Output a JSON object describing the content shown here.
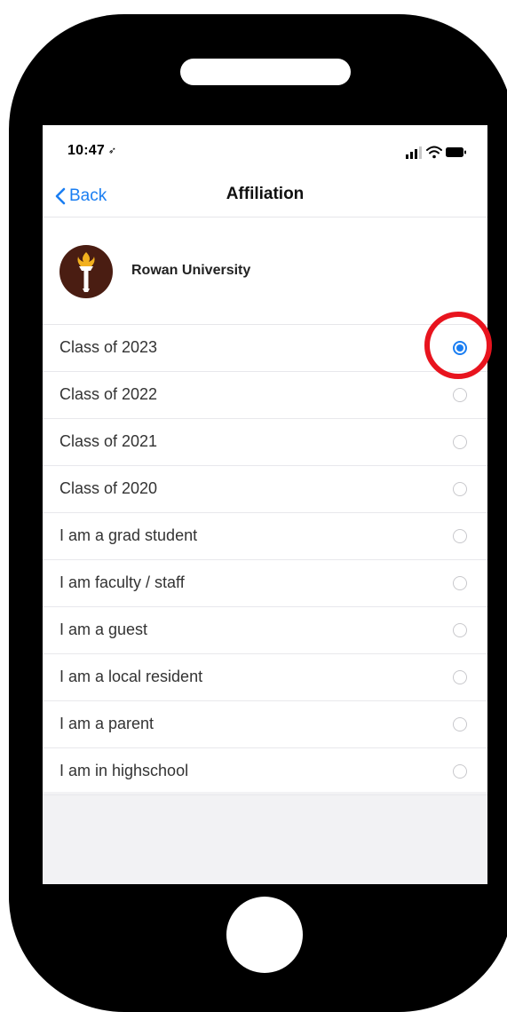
{
  "status_bar": {
    "time": "10:47",
    "location_icon": "location-arrow-icon",
    "signal_icon": "cellular-signal-icon",
    "wifi_icon": "wifi-icon",
    "battery_icon": "battery-icon"
  },
  "nav": {
    "back_label": "Back",
    "back_icon": "chevron-left-icon",
    "title": "Affiliation"
  },
  "university": {
    "name": "Rowan University",
    "logo_icon": "torch-logo-icon",
    "logo_color": "#4a1d12"
  },
  "options": [
    {
      "label": "Class of 2023",
      "selected": true
    },
    {
      "label": "Class of 2022",
      "selected": false
    },
    {
      "label": "Class of 2021",
      "selected": false
    },
    {
      "label": "Class of 2020",
      "selected": false
    },
    {
      "label": "I am a grad student",
      "selected": false
    },
    {
      "label": "I am faculty / staff",
      "selected": false
    },
    {
      "label": "I am a guest",
      "selected": false
    },
    {
      "label": "I am a local resident",
      "selected": false
    },
    {
      "label": "I am a parent",
      "selected": false
    },
    {
      "label": "I am in highschool",
      "selected": false
    }
  ],
  "colors": {
    "accent": "#1a7ef2",
    "highlight_ring": "#e8141e",
    "phone_frame": "#000000"
  }
}
